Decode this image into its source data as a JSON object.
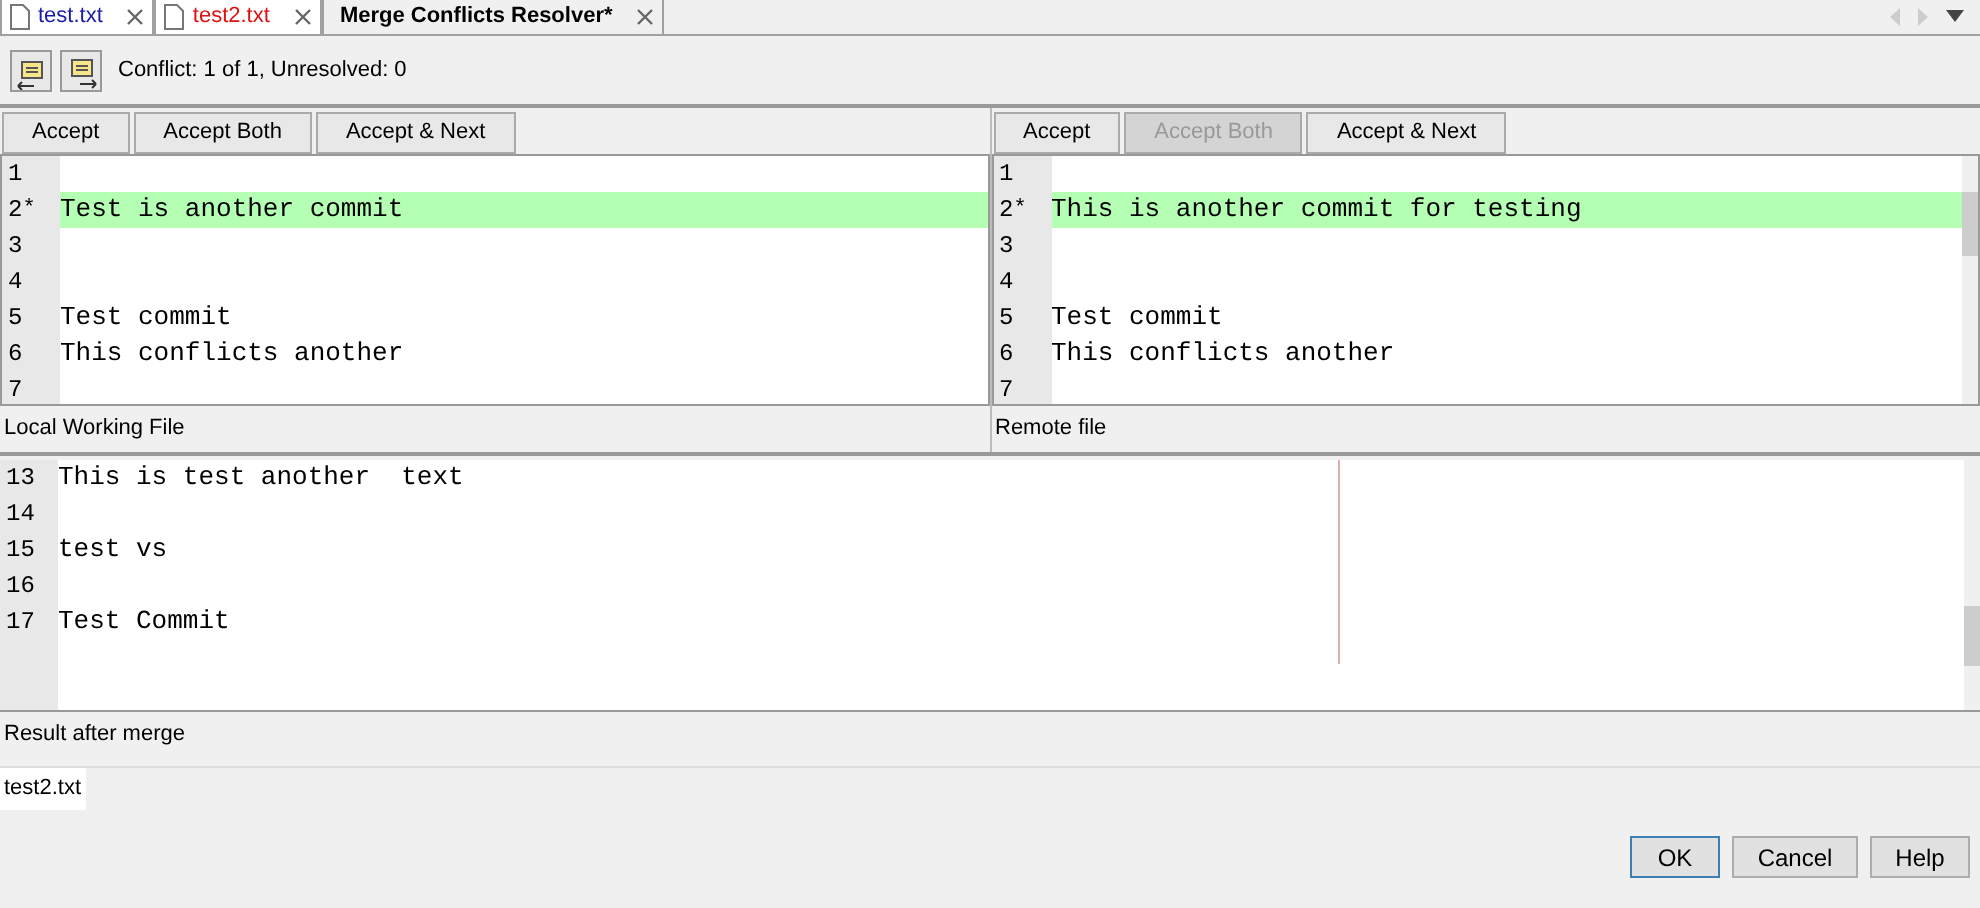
{
  "tabs": [
    {
      "label": "test.txt",
      "selected": false,
      "color": "#1a1aa6",
      "kind": "file"
    },
    {
      "label": "test2.txt",
      "selected": false,
      "color": "#e01010",
      "kind": "file"
    },
    {
      "label": "Merge Conflicts Resolver*",
      "selected": true,
      "color": "#000000",
      "kind": "plain"
    }
  ],
  "toolbar": {
    "status": "Conflict: 1 of 1, Unresolved: 0"
  },
  "panes": [
    {
      "buttons": [
        {
          "label": "Accept",
          "disabled": false
        },
        {
          "label": "Accept Both",
          "disabled": false
        },
        {
          "label": "Accept & Next",
          "disabled": false
        }
      ],
      "lines": [
        {
          "number": "1",
          "highlighted": false
        },
        {
          "number": "2",
          "marker": "*",
          "text": "Test is another commit",
          "highlighted": true
        },
        {
          "number": "3",
          "highlighted": false
        },
        {
          "number": "4",
          "highlighted": false
        },
        {
          "number": "5",
          "text": "Test commit",
          "highlighted": false
        },
        {
          "number": "6",
          "text": "This conflicts another",
          "highlighted": false
        },
        {
          "number": "7",
          "highlighted": false
        }
      ],
      "caption": "Local Working File"
    },
    {
      "buttons": [
        {
          "label": "Accept",
          "disabled": false
        },
        {
          "label": "Accept Both",
          "disabled": true
        },
        {
          "label": "Accept & Next",
          "disabled": false
        }
      ],
      "lines": [
        {
          "number": "1",
          "highlighted": false
        },
        {
          "number": "2",
          "marker": "*",
          "text": "This is another commit for testing",
          "highlighted": true
        },
        {
          "number": "3",
          "highlighted": false
        },
        {
          "number": "4",
          "highlighted": false
        },
        {
          "number": "5",
          "text": "Test commit",
          "highlighted": false
        },
        {
          "number": "6",
          "text": "This conflicts another",
          "highlighted": false
        },
        {
          "number": "7",
          "highlighted": false
        }
      ],
      "caption": "Remote file"
    }
  ],
  "result": {
    "lines": [
      {
        "number": "13",
        "text": "This is test another  text"
      },
      {
        "number": "14"
      },
      {
        "number": "15",
        "text": "test vs"
      },
      {
        "number": "16"
      },
      {
        "number": "17",
        "text": "Test Commit"
      }
    ],
    "caption": "Result after merge"
  },
  "bottom_tab": {
    "label": "test2.txt"
  },
  "dialog_buttons": [
    {
      "label": "OK",
      "selected": true
    },
    {
      "label": "Cancel",
      "selected": false
    },
    {
      "label": "Help",
      "selected": false
    }
  ]
}
